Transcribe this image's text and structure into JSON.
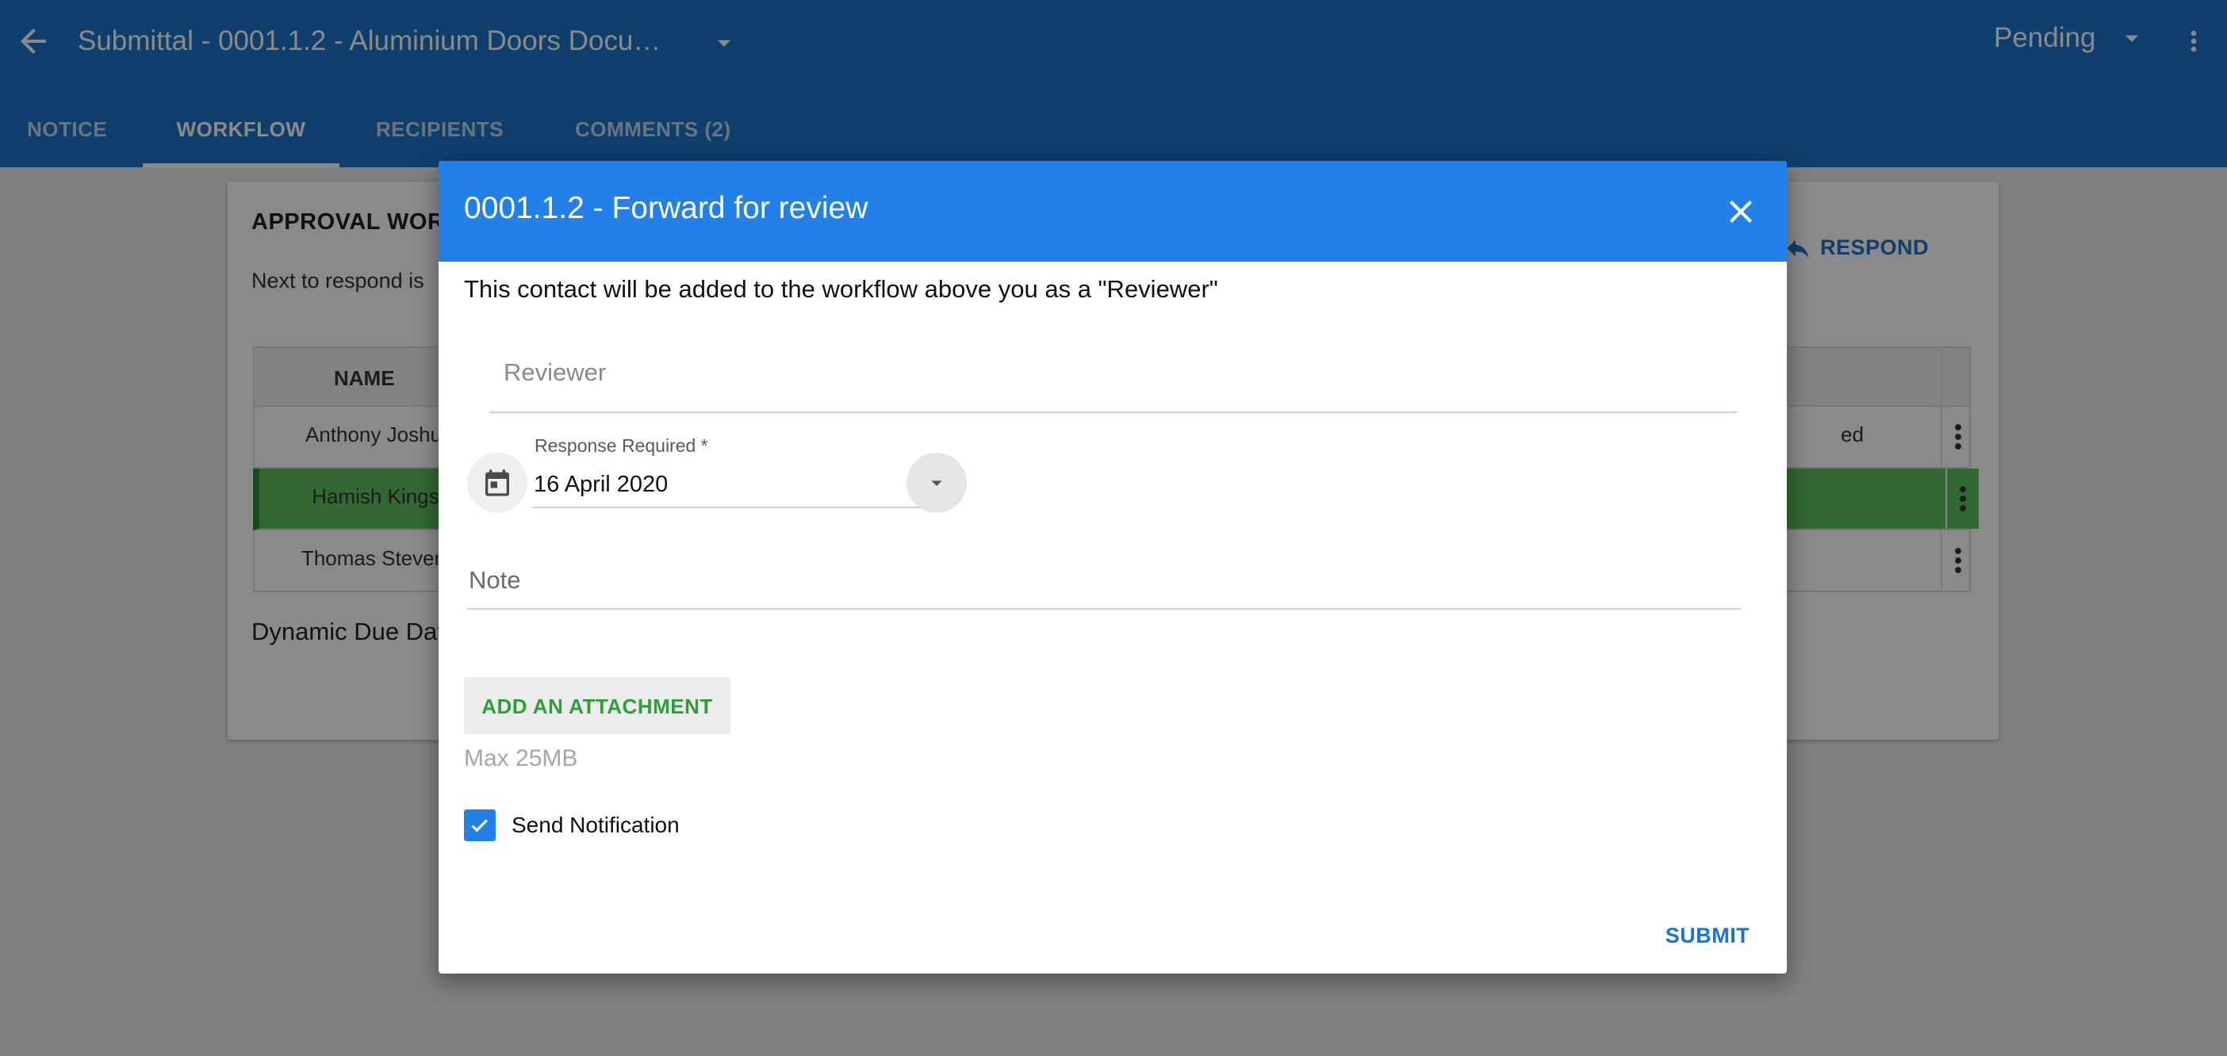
{
  "app_bar": {
    "title": "Submittal - 0001.1.2 - Aluminium Doors Docu…",
    "status": "Pending",
    "icons": {
      "back": "arrow-left-icon",
      "title_dropdown": "caret-down-icon",
      "status_dropdown": "caret-down-icon",
      "more": "more-vert-icon"
    }
  },
  "tabs": [
    {
      "label": "NOTICE",
      "active": false
    },
    {
      "label": "WORKFLOW",
      "active": true
    },
    {
      "label": "RECIPIENTS",
      "active": false
    },
    {
      "label": "COMMENTS (2)",
      "active": false
    }
  ],
  "workflow_card": {
    "title": "APPROVAL WOR",
    "next_to_respond": "Next to respond is",
    "respond_label": "RESPOND",
    "respond_icon": "reply-icon",
    "table": {
      "header_name": "NAME",
      "rows": [
        {
          "name": "Anthony Joshu",
          "status": "ed",
          "highlighted": false
        },
        {
          "name": "Hamish Kingst",
          "status": "",
          "highlighted": true
        },
        {
          "name": "Thomas Steven",
          "status": "",
          "highlighted": false
        }
      ]
    },
    "dynamic_due": "Dynamic Due Dat"
  },
  "dialog": {
    "title": "0001.1.2 - Forward for review",
    "close_icon": "close-icon",
    "info": "This contact will be added to the workflow above you as a \"Reviewer\"",
    "reviewer_placeholder": "Reviewer",
    "response_required_label": "Response Required *",
    "response_required_value": "16 April 2020",
    "calendar_icon": "calendar-icon",
    "date_dropdown_icon": "caret-down-icon",
    "note_placeholder": "Note",
    "attach_label": "ADD AN ATTACHMENT",
    "max_size": "Max 25MB",
    "send_notification_label": "Send Notification",
    "send_notification_checked": true,
    "submit_label": "SUBMIT"
  },
  "colors": {
    "app_bar": "#1e73c8",
    "dialog_header": "#2280e8",
    "highlight_row": "#5fc163",
    "attach_text": "#2e9e3a",
    "link_blue": "#1e73c8"
  }
}
